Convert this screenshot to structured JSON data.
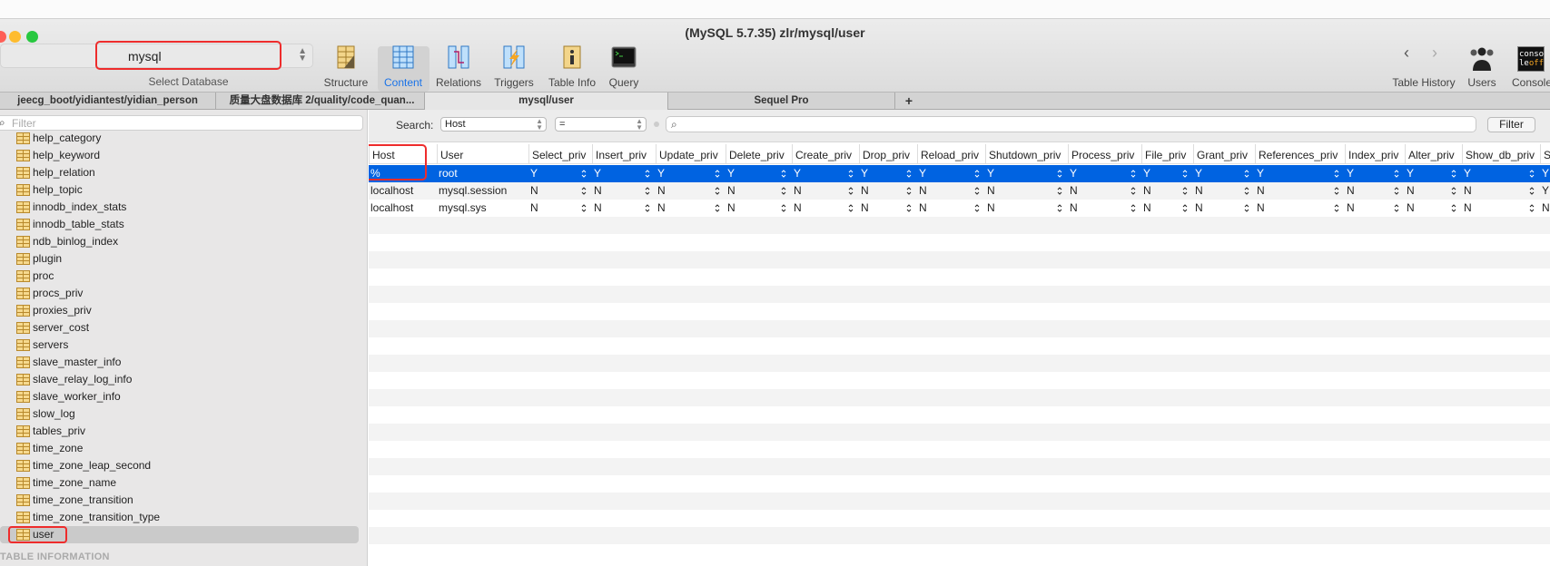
{
  "window": {
    "title": "(MySQL 5.7.35) zlr/mysql/user"
  },
  "toolbar": {
    "database": {
      "value": "mysql",
      "label": "Select Database"
    },
    "buttons": [
      {
        "label": "Structure",
        "icon": "structure-icon"
      },
      {
        "label": "Content",
        "icon": "content-icon",
        "active": true
      },
      {
        "label": "Relations",
        "icon": "relations-icon"
      },
      {
        "label": "Triggers",
        "icon": "triggers-icon"
      },
      {
        "label": "Table Info",
        "icon": "table-info-icon"
      },
      {
        "label": "Query",
        "icon": "query-icon"
      }
    ],
    "table_history": "Table History",
    "users": "Users",
    "console": "Console",
    "console_icon_text": "console off"
  },
  "tabs": [
    {
      "label": "jeecg_boot/yidiantest/yidian_person"
    },
    {
      "label": "质量大盘数据库 2/quality/code_quan..."
    },
    {
      "label": "mysql/user",
      "active": true
    },
    {
      "label": "Sequel Pro"
    },
    {
      "label": "+"
    }
  ],
  "sidebar": {
    "filter_placeholder": "Filter",
    "tables": [
      "help_category",
      "help_keyword",
      "help_relation",
      "help_topic",
      "innodb_index_stats",
      "innodb_table_stats",
      "ndb_binlog_index",
      "plugin",
      "proc",
      "procs_priv",
      "proxies_priv",
      "server_cost",
      "servers",
      "slave_master_info",
      "slave_relay_log_info",
      "slave_worker_info",
      "slow_log",
      "tables_priv",
      "time_zone",
      "time_zone_leap_second",
      "time_zone_name",
      "time_zone_transition",
      "time_zone_transition_type",
      "user"
    ],
    "selected": "user",
    "section": "TABLE INFORMATION"
  },
  "search": {
    "label": "Search:",
    "field": "Host",
    "operator": "=",
    "value": "",
    "filter_button": "Filter"
  },
  "table": {
    "columns": [
      "Host",
      "User",
      "Select_priv",
      "Insert_priv",
      "Update_priv",
      "Delete_priv",
      "Create_priv",
      "Drop_priv",
      "Reload_priv",
      "Shutdown_priv",
      "Process_priv",
      "File_priv",
      "Grant_priv",
      "References_priv",
      "Index_priv",
      "Alter_priv",
      "Show_db_priv",
      "Su"
    ],
    "rows": [
      [
        "%",
        "root",
        "Y",
        "Y",
        "Y",
        "Y",
        "Y",
        "Y",
        "Y",
        "Y",
        "Y",
        "Y",
        "Y",
        "Y",
        "Y",
        "Y",
        "Y",
        "Y"
      ],
      [
        "localhost",
        "mysql.session",
        "N",
        "N",
        "N",
        "N",
        "N",
        "N",
        "N",
        "N",
        "N",
        "N",
        "N",
        "N",
        "N",
        "N",
        "N",
        "Y"
      ],
      [
        "localhost",
        "mysql.sys",
        "N",
        "N",
        "N",
        "N",
        "N",
        "N",
        "N",
        "N",
        "N",
        "N",
        "N",
        "N",
        "N",
        "N",
        "N",
        "N"
      ]
    ],
    "selected_row": 0,
    "accent": "#0063e1"
  },
  "highlight_color": "#ee2c2c"
}
